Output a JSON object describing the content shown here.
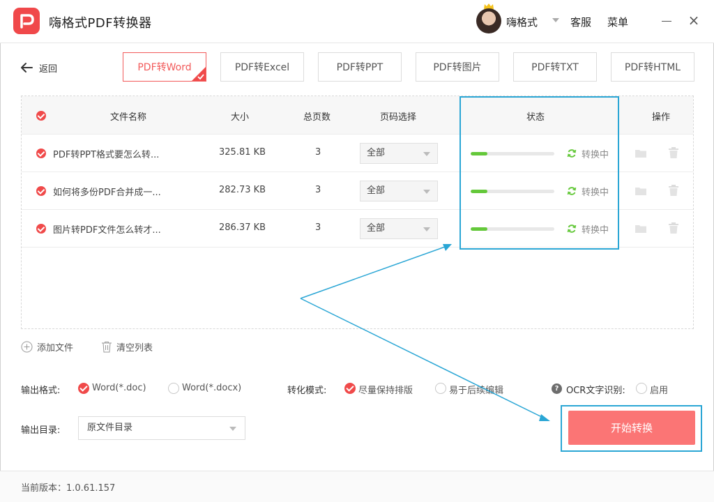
{
  "app": {
    "title": "嗨格式PDF转换器"
  },
  "header": {
    "username": "嗨格式",
    "service_label": "客服",
    "menu_label": "菜单"
  },
  "toolbar": {
    "back_label": "返回",
    "tabs": [
      {
        "label": "PDF转Word",
        "active": true
      },
      {
        "label": "PDF转Excel",
        "active": false
      },
      {
        "label": "PDF转PPT",
        "active": false
      },
      {
        "label": "PDF转图片",
        "active": false
      },
      {
        "label": "PDF转TXT",
        "active": false
      },
      {
        "label": "PDF转HTML",
        "active": false
      }
    ]
  },
  "table": {
    "columns": {
      "name": "文件名称",
      "size": "大小",
      "pages": "总页数",
      "page_select": "页码选择",
      "status": "状态",
      "actions": "操作"
    },
    "rows": [
      {
        "name": "PDF转PPT格式要怎么转...",
        "size": "325.81 KB",
        "pages": "3",
        "page_select": "全部",
        "progress": 0.2,
        "status": "转换中"
      },
      {
        "name": "如何将多份PDF合并成一...",
        "size": "282.73 KB",
        "pages": "3",
        "page_select": "全部",
        "progress": 0.2,
        "status": "转换中"
      },
      {
        "name": "图片转PDF文件怎么转才...",
        "size": "286.37 KB",
        "pages": "3",
        "page_select": "全部",
        "progress": 0.2,
        "status": "转换中"
      }
    ]
  },
  "list_actions": {
    "add_file": "添加文件",
    "clear_list": "清空列表"
  },
  "options": {
    "format_label": "输出格式:",
    "format_doc": "Word(*.doc)",
    "format_docx": "Word(*.docx)",
    "mode_label": "转化模式:",
    "mode_keep_layout": "尽量保持排版",
    "mode_easy_edit": "易于后续编辑",
    "ocr_label": "OCR文字识别:",
    "ocr_enable": "启用",
    "dir_label": "输出目录:",
    "dir_value": "原文件目录"
  },
  "start_button": "开始转换",
  "footer": {
    "version": "当前版本：1.0.61.157"
  },
  "colors": {
    "brand_red": "#f04a4a",
    "progress_green": "#64c83a",
    "highlight_blue": "#2aa6d5",
    "start_button": "#fb7575"
  }
}
